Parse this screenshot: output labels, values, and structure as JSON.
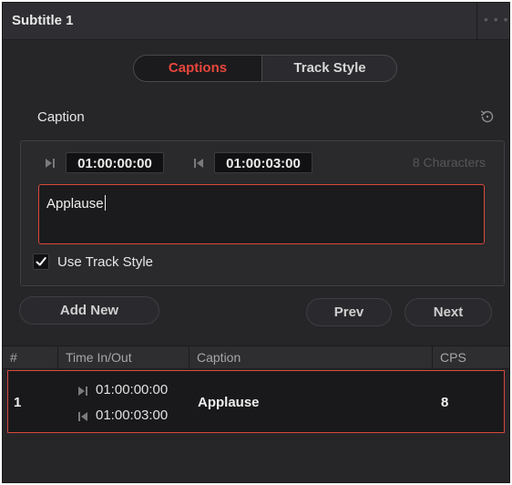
{
  "panel": {
    "title": "Subtitle 1",
    "menu_icon": "ellipsis-icon"
  },
  "tabs": [
    {
      "label": "Captions",
      "active": true
    },
    {
      "label": "Track Style",
      "active": false
    }
  ],
  "caption_section": {
    "title": "Caption",
    "reset_icon": "reset-icon",
    "time_in": "01:00:00:00",
    "time_out": "01:00:03:00",
    "char_count": "8 Characters",
    "text": "Applause",
    "use_track_style_label": "Use Track Style",
    "use_track_style_checked": true
  },
  "actions": {
    "add_new": "Add New",
    "prev": "Prev",
    "next": "Next"
  },
  "table": {
    "columns": [
      "#",
      "Time In/Out",
      "Caption",
      "CPS"
    ],
    "rows": [
      {
        "index": "1",
        "time_in": "01:00:00:00",
        "time_out": "01:00:03:00",
        "caption": "Applause",
        "cps": "8",
        "selected": true
      }
    ]
  },
  "colors": {
    "accent": "#e8473c",
    "panel_bg": "#262629",
    "field_bg": "#111113"
  }
}
